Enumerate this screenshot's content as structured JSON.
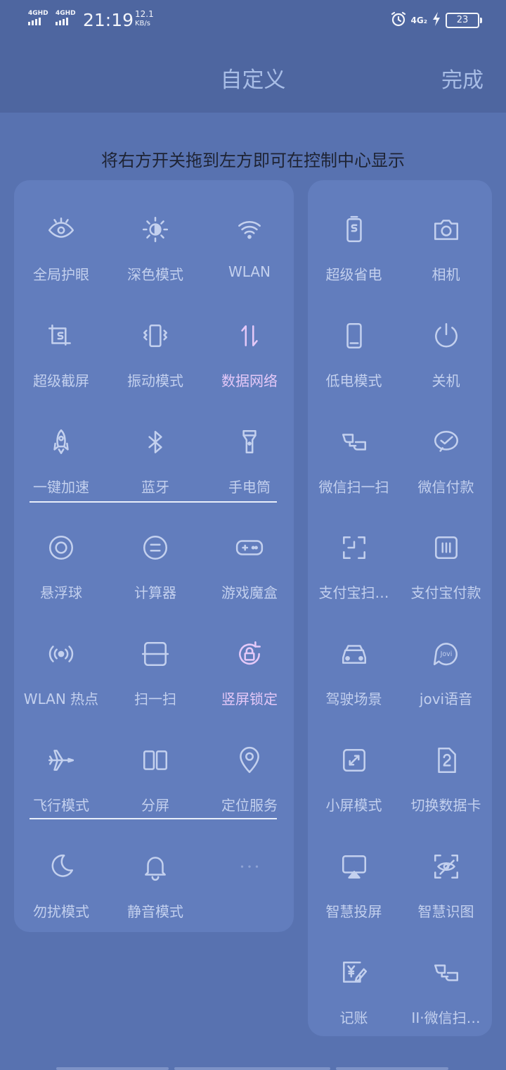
{
  "status_bar": {
    "sim1": "4GHD",
    "sim2": "4GHD",
    "time": "21:19",
    "speed_value": "12.1",
    "speed_unit": "KB/s",
    "network": "4G₂",
    "battery": "23",
    "icons": [
      "alarm-icon",
      "charging-icon"
    ]
  },
  "header": {
    "title": "自定义",
    "done_label": "完成"
  },
  "hint": "将右方开关拖到左方即可在控制中心显示",
  "left_panel": {
    "tiles": [
      {
        "label": "全局护眼",
        "icon": "eye-icon",
        "active": false
      },
      {
        "label": "深色模式",
        "icon": "sun-icon",
        "active": false
      },
      {
        "label": "WLAN",
        "icon": "wifi-icon",
        "active": false
      },
      {
        "label": "超级截屏",
        "icon": "screenshot-icon",
        "active": false
      },
      {
        "label": "振动模式",
        "icon": "vibrate-icon",
        "active": false
      },
      {
        "label": "数据网络",
        "icon": "data-arrows-icon",
        "active": true
      },
      {
        "label": "一键加速",
        "icon": "rocket-icon",
        "active": false
      },
      {
        "label": "蓝牙",
        "icon": "bluetooth-icon",
        "active": false
      },
      {
        "label": "手电筒",
        "icon": "flashlight-icon",
        "active": false
      },
      {
        "label": "悬浮球",
        "icon": "float-ball-icon",
        "active": false
      },
      {
        "label": "计算器",
        "icon": "calculator-icon",
        "active": false
      },
      {
        "label": "游戏魔盒",
        "icon": "gamepad-icon",
        "active": false
      },
      {
        "label": "WLAN 热点",
        "icon": "hotspot-icon",
        "active": false
      },
      {
        "label": "扫一扫",
        "icon": "scan-icon",
        "active": false
      },
      {
        "label": "竖屏锁定",
        "icon": "rotation-lock-icon",
        "active": true
      },
      {
        "label": "飞行模式",
        "icon": "airplane-icon",
        "active": false
      },
      {
        "label": "分屏",
        "icon": "split-screen-icon",
        "active": false
      },
      {
        "label": "定位服务",
        "icon": "location-icon",
        "active": false
      },
      {
        "label": "勿扰模式",
        "icon": "moon-icon",
        "active": false
      },
      {
        "label": "静音模式",
        "icon": "bell-icon",
        "active": false
      },
      {
        "label": "",
        "icon": "more-dots-icon",
        "active": false
      }
    ]
  },
  "right_panel": {
    "tiles": [
      {
        "label": "超级省电",
        "icon": "battery-saver-icon"
      },
      {
        "label": "相机",
        "icon": "camera-icon"
      },
      {
        "label": "低电模式",
        "icon": "low-battery-icon"
      },
      {
        "label": "关机",
        "icon": "power-icon"
      },
      {
        "label": "微信扫一扫",
        "icon": "wechat-scan-icon"
      },
      {
        "label": "微信付款",
        "icon": "wechat-pay-icon"
      },
      {
        "label": "支付宝扫…",
        "icon": "alipay-scan-icon"
      },
      {
        "label": "支付宝付款",
        "icon": "alipay-pay-icon"
      },
      {
        "label": "驾驶场景",
        "icon": "car-icon"
      },
      {
        "label": "jovi语音",
        "icon": "jovi-icon"
      },
      {
        "label": "小屏模式",
        "icon": "small-screen-icon"
      },
      {
        "label": "切换数据卡",
        "icon": "sim-switch-icon"
      },
      {
        "label": "智慧投屏",
        "icon": "cast-icon"
      },
      {
        "label": "智慧识图",
        "icon": "image-recognition-icon"
      },
      {
        "label": "记账",
        "icon": "bookkeeping-icon"
      },
      {
        "label": "II·微信扫…",
        "icon": "wechat-scan-2-icon"
      }
    ]
  },
  "colors": {
    "background": "#5872b0",
    "header": "#4e66a0",
    "panel": "#627dbd",
    "icon": "#c3d0ee",
    "active": "#e4c8f8"
  }
}
